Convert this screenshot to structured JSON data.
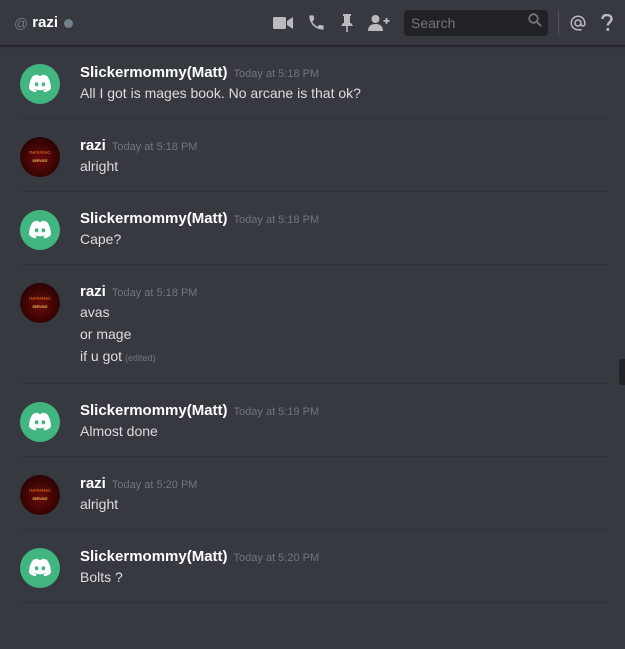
{
  "header": {
    "at_symbol": "@",
    "username": "razi",
    "search_placeholder": "Search",
    "icons": [
      "video-call-icon",
      "voice-call-icon",
      "pin-icon",
      "add-friend-icon",
      "search-icon",
      "mention-icon",
      "help-icon"
    ]
  },
  "colors": {
    "background": "#36393f",
    "header_border": "#202225",
    "discord_avatar": "#43b581",
    "status_offline": "#747f8d",
    "timestamp": "#72767d"
  },
  "avatar_text": {
    "line1": "INFERNO",
    "line2": "SERVICE"
  },
  "messages": [
    {
      "author": "Slickermommy(Matt)",
      "timestamp": "Today at 5:18 PM",
      "lines": [
        "All I got is mages book. No arcane is that ok?"
      ]
    },
    {
      "author": "razi",
      "timestamp": "Today at 5:18 PM",
      "lines": [
        "alright"
      ]
    },
    {
      "author": "Slickermommy(Matt)",
      "timestamp": "Today at 5:18 PM",
      "lines": [
        "Cape?"
      ]
    },
    {
      "author": "razi",
      "timestamp": "Today at 5:18 PM",
      "lines": [
        "avas",
        "or mage",
        "if u got"
      ],
      "edited_label": "(edited)"
    },
    {
      "author": "Slickermommy(Matt)",
      "timestamp": "Today at 5:19 PM",
      "lines": [
        "Almost done"
      ]
    },
    {
      "author": "razi",
      "timestamp": "Today at 5:20 PM",
      "lines": [
        "alright"
      ]
    },
    {
      "author": "Slickermommy(Matt)",
      "timestamp": "Today at 5:20 PM",
      "lines": [
        "Bolts ?"
      ]
    }
  ]
}
